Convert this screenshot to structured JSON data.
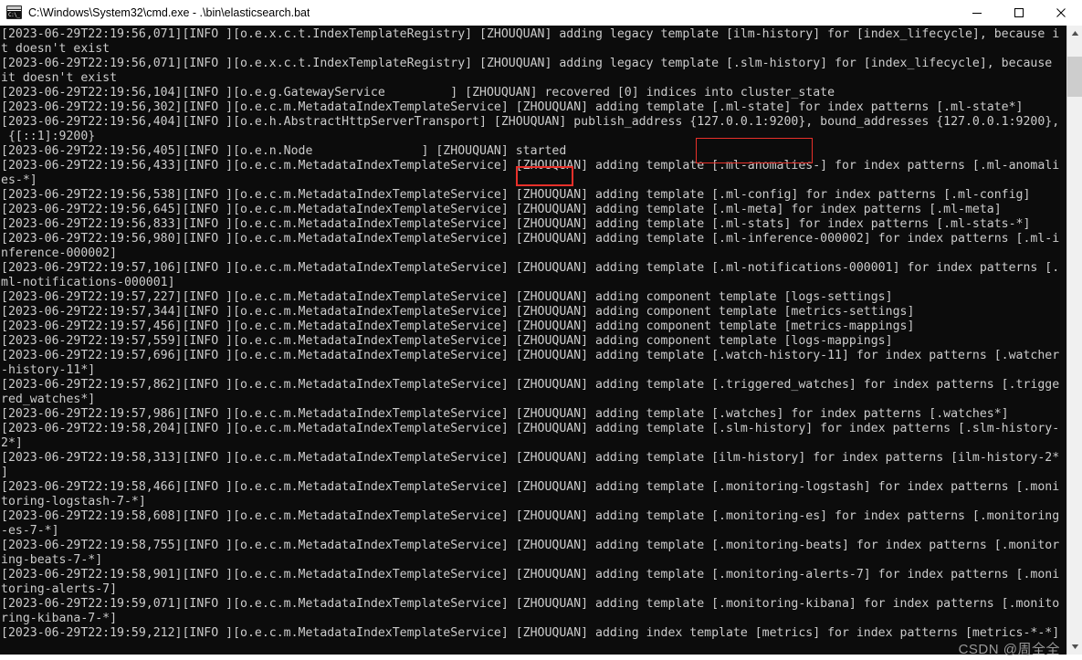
{
  "window": {
    "title": "C:\\Windows\\System32\\cmd.exe - .\\bin\\elasticsearch.bat",
    "icon": "cmd-icon",
    "icon_text": "C:\\_",
    "background_color": "#0c0c0c",
    "foreground_color": "#cccccc",
    "titlebar_color": "#ffffff"
  },
  "controls": {
    "minimize_label": "Minimize",
    "maximize_label": "Maximize",
    "close_label": "Close"
  },
  "scrollbar": {
    "up_arrow_label": "Scroll up",
    "down_arrow_label": "Scroll down",
    "thumb_label": "Scrollbar thumb"
  },
  "highlights": [
    {
      "name": "publish-address-highlight",
      "text": "{127.0.0.1:9200},",
      "color": "#e8302a"
    },
    {
      "name": "started-highlight",
      "text": "started",
      "color": "#e8302a"
    }
  ],
  "watermark": {
    "text": "CSDN @周全全"
  },
  "console": {
    "text": "[2023-06-29T22:19:56,071][INFO ][o.e.x.c.t.IndexTemplateRegistry] [ZHOUQUAN] adding legacy template [ilm-history] for [index_lifecycle], because i\nt doesn't exist\n[2023-06-29T22:19:56,071][INFO ][o.e.x.c.t.IndexTemplateRegistry] [ZHOUQUAN] adding legacy template [.slm-history] for [index_lifecycle], because\nit doesn't exist\n[2023-06-29T22:19:56,104][INFO ][o.e.g.GatewayService         ] [ZHOUQUAN] recovered [0] indices into cluster_state\n[2023-06-29T22:19:56,302][INFO ][o.e.c.m.MetadataIndexTemplateService] [ZHOUQUAN] adding template [.ml-state] for index patterns [.ml-state*]\n[2023-06-29T22:19:56,404][INFO ][o.e.h.AbstractHttpServerTransport] [ZHOUQUAN] publish_address {127.0.0.1:9200}, bound_addresses {127.0.0.1:9200},\n {[::1]:9200}\n[2023-06-29T22:19:56,405][INFO ][o.e.n.Node               ] [ZHOUQUAN] started\n[2023-06-29T22:19:56,433][INFO ][o.e.c.m.MetadataIndexTemplateService] [ZHOUQUAN] adding template [.ml-anomalies-] for index patterns [.ml-anomali\nes-*]\n[2023-06-29T22:19:56,538][INFO ][o.e.c.m.MetadataIndexTemplateService] [ZHOUQUAN] adding template [.ml-config] for index patterns [.ml-config]\n[2023-06-29T22:19:56,645][INFO ][o.e.c.m.MetadataIndexTemplateService] [ZHOUQUAN] adding template [.ml-meta] for index patterns [.ml-meta]\n[2023-06-29T22:19:56,833][INFO ][o.e.c.m.MetadataIndexTemplateService] [ZHOUQUAN] adding template [.ml-stats] for index patterns [.ml-stats-*]\n[2023-06-29T22:19:56,980][INFO ][o.e.c.m.MetadataIndexTemplateService] [ZHOUQUAN] adding template [.ml-inference-000002] for index patterns [.ml-i\nnference-000002]\n[2023-06-29T22:19:57,106][INFO ][o.e.c.m.MetadataIndexTemplateService] [ZHOUQUAN] adding template [.ml-notifications-000001] for index patterns [.\nml-notifications-000001]\n[2023-06-29T22:19:57,227][INFO ][o.e.c.m.MetadataIndexTemplateService] [ZHOUQUAN] adding component template [logs-settings]\n[2023-06-29T22:19:57,344][INFO ][o.e.c.m.MetadataIndexTemplateService] [ZHOUQUAN] adding component template [metrics-settings]\n[2023-06-29T22:19:57,456][INFO ][o.e.c.m.MetadataIndexTemplateService] [ZHOUQUAN] adding component template [metrics-mappings]\n[2023-06-29T22:19:57,559][INFO ][o.e.c.m.MetadataIndexTemplateService] [ZHOUQUAN] adding component template [logs-mappings]\n[2023-06-29T22:19:57,696][INFO ][o.e.c.m.MetadataIndexTemplateService] [ZHOUQUAN] adding template [.watch-history-11] for index patterns [.watcher\n-history-11*]\n[2023-06-29T22:19:57,862][INFO ][o.e.c.m.MetadataIndexTemplateService] [ZHOUQUAN] adding template [.triggered_watches] for index patterns [.trigge\nred_watches*]\n[2023-06-29T22:19:57,986][INFO ][o.e.c.m.MetadataIndexTemplateService] [ZHOUQUAN] adding template [.watches] for index patterns [.watches*]\n[2023-06-29T22:19:58,204][INFO ][o.e.c.m.MetadataIndexTemplateService] [ZHOUQUAN] adding template [.slm-history] for index patterns [.slm-history-\n2*]\n[2023-06-29T22:19:58,313][INFO ][o.e.c.m.MetadataIndexTemplateService] [ZHOUQUAN] adding template [ilm-history] for index patterns [ilm-history-2*\n]\n[2023-06-29T22:19:58,466][INFO ][o.e.c.m.MetadataIndexTemplateService] [ZHOUQUAN] adding template [.monitoring-logstash] for index patterns [.moni\ntoring-logstash-7-*]\n[2023-06-29T22:19:58,608][INFO ][o.e.c.m.MetadataIndexTemplateService] [ZHOUQUAN] adding template [.monitoring-es] for index patterns [.monitoring\n-es-7-*]\n[2023-06-29T22:19:58,755][INFO ][o.e.c.m.MetadataIndexTemplateService] [ZHOUQUAN] adding template [.monitoring-beats] for index patterns [.monitor\ning-beats-7-*]\n[2023-06-29T22:19:58,901][INFO ][o.e.c.m.MetadataIndexTemplateService] [ZHOUQUAN] adding template [.monitoring-alerts-7] for index patterns [.moni\ntoring-alerts-7]\n[2023-06-29T22:19:59,071][INFO ][o.e.c.m.MetadataIndexTemplateService] [ZHOUQUAN] adding template [.monitoring-kibana] for index patterns [.monito\nring-kibana-7-*]\n[2023-06-29T22:19:59,212][INFO ][o.e.c.m.MetadataIndexTemplateService] [ZHOUQUAN] adding index template [metrics] for index patterns [metrics-*-*]"
  }
}
